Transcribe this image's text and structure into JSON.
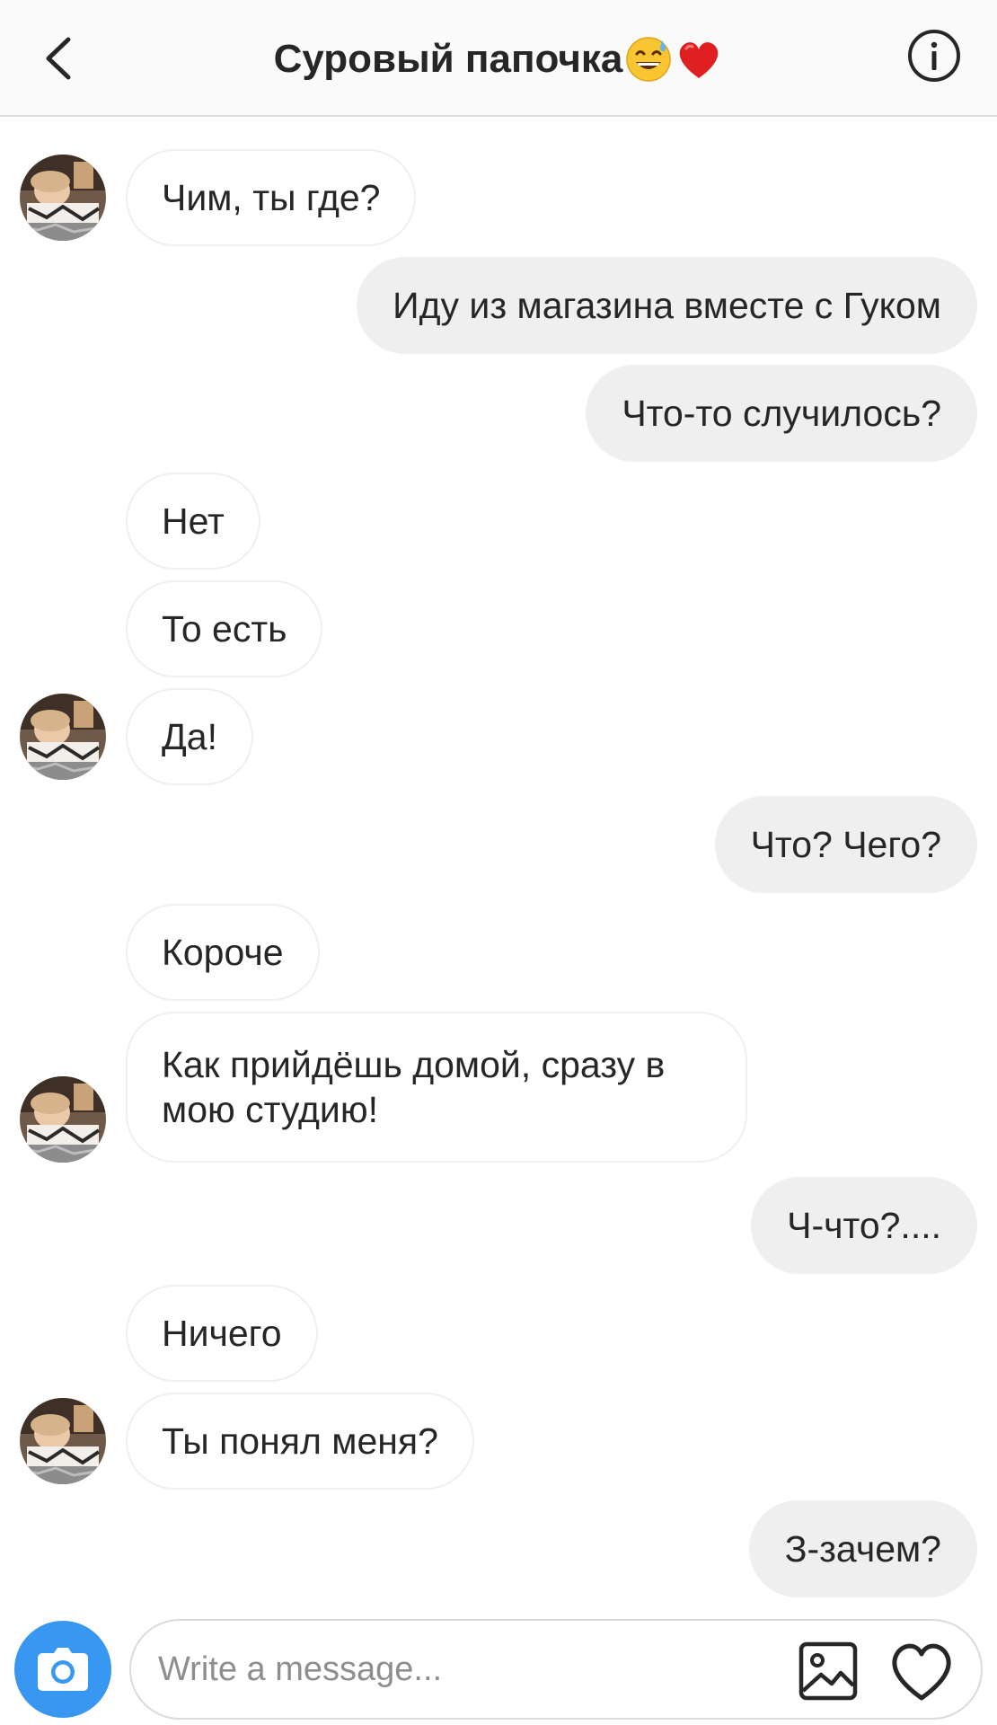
{
  "header": {
    "title": "Суровый папочка",
    "title_emojis": [
      "grinning-sweat-emoji",
      "red-heart-emoji"
    ],
    "back_icon": "chevron-left-icon",
    "info_icon": "info-circle-icon"
  },
  "messages": [
    {
      "from": "other",
      "text": "Чим, ты где?",
      "avatar": true
    },
    {
      "from": "me",
      "text": "Иду из магазина вместе с Гуком"
    },
    {
      "from": "me",
      "text": "Что-то случилось?"
    },
    {
      "from": "other",
      "text": "Нет",
      "avatar": false
    },
    {
      "from": "other",
      "text": "То есть",
      "avatar": false
    },
    {
      "from": "other",
      "text": "Да!",
      "avatar": true
    },
    {
      "from": "me",
      "text": "Что? Чего?"
    },
    {
      "from": "other",
      "text": "Короче",
      "avatar": false
    },
    {
      "from": "other",
      "text": "Как прийдёшь домой, сразу в мою студию!",
      "avatar": true
    },
    {
      "from": "me",
      "text": "Ч-что?...."
    },
    {
      "from": "other",
      "text": "Ничего",
      "avatar": false
    },
    {
      "from": "other",
      "text": "Ты понял меня?",
      "avatar": true
    },
    {
      "from": "me",
      "text": "З-зачем?"
    }
  ],
  "composer": {
    "placeholder": "Write a message...",
    "camera_icon": "camera-icon",
    "gallery_icon": "gallery-icon",
    "like_icon": "heart-icon"
  },
  "colors": {
    "accent": "#3897f0",
    "outgoing_bubble": "#efefef",
    "incoming_border": "#efefef",
    "placeholder": "#8e8e8e"
  }
}
